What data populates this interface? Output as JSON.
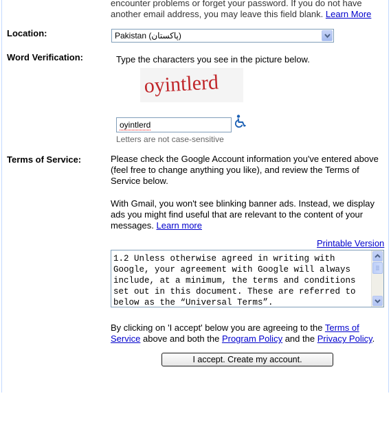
{
  "intro": {
    "line1": "encounter problems or forget your password. If you do not have",
    "line2": "another email address, you may leave this field blank.",
    "learn_more": "Learn More"
  },
  "location": {
    "label": "Location:",
    "selected": "Pakistan (پاکستان)"
  },
  "word_verification": {
    "label": "Word Verification:",
    "instruction": "Type the characters you see in the picture below.",
    "captcha_text": "oyintlerd",
    "input_value": "oyintlerd",
    "hint": "Letters are not case-sensitive"
  },
  "terms": {
    "label": "Terms of Service:",
    "para1": "Please check the Google Account information you've entered above (feel free to change anything you like), and review the Terms of Service below.",
    "para2": "With Gmail, you won't see blinking banner ads. Instead, we display ads you might find useful that are relevant to the content of your messages.",
    "learn_more": "Learn more",
    "printable_version": "Printable Version",
    "tos_text": "1.2 Unless otherwise agreed in writing with Google, your agreement with Google will always include, at a minimum, the terms and conditions set out in this document. These are referred to below as the “Universal Terms”.",
    "agree_prefix": "By clicking on 'I accept' below you are agreeing to the",
    "terms_link": "Terms of Service",
    "agree_mid": "above and both the",
    "program_policy": "Program Policy",
    "agree_and": "and the",
    "privacy_policy": "Privacy Policy",
    "agree_end": "."
  },
  "submit_label": "I accept. Create my account.",
  "colors": {
    "link": "#0000cc",
    "frame": "#c3d9ff",
    "captcha": "#c0262a"
  },
  "icons": {
    "wheelchair": "wheelchair-icon",
    "dropdown": "chevron-down-icon"
  }
}
